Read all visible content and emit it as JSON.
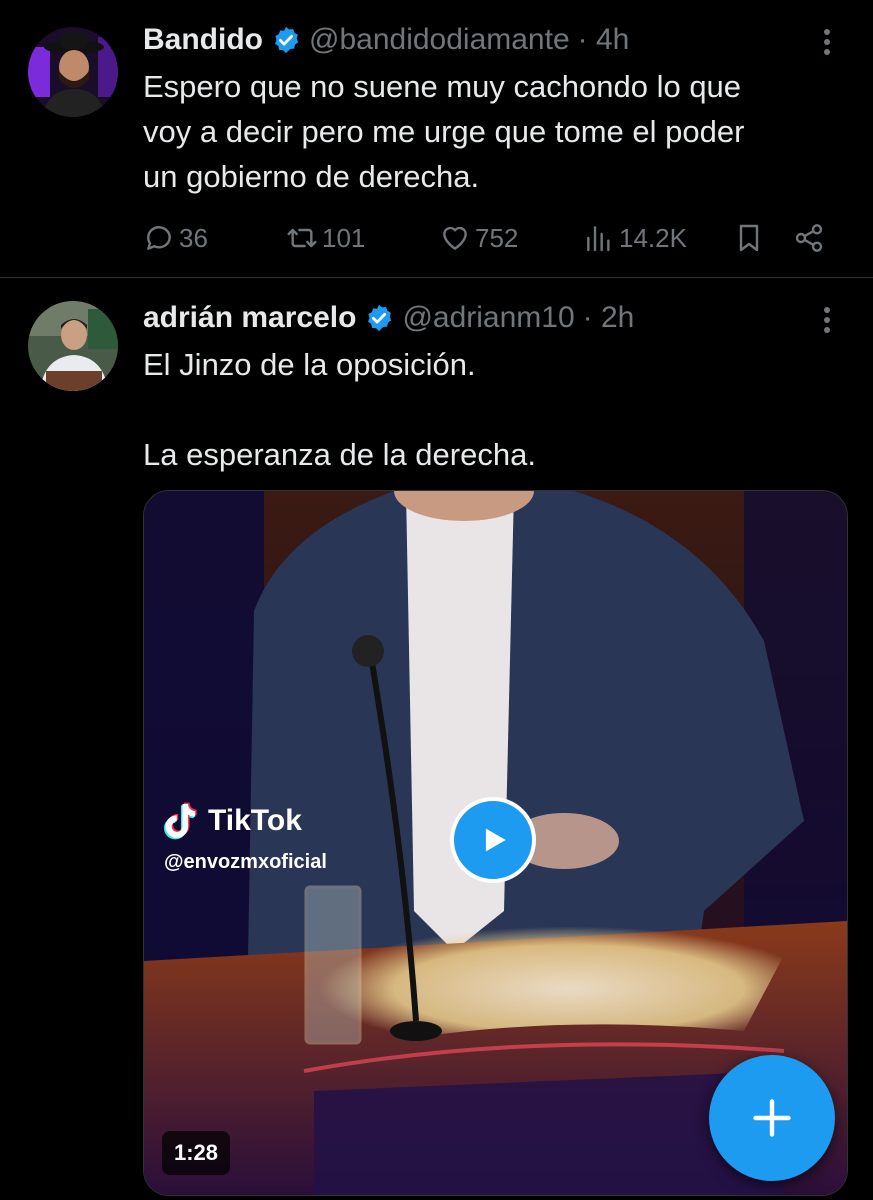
{
  "tweets": [
    {
      "name": "Bandido",
      "handle": "@bandidodiamante",
      "time": "· 4h",
      "lines": [
        "Espero que no suene muy cachondo lo que",
        "voy a decir pero me urge que tome el poder",
        "un gobierno de derecha."
      ],
      "stats": {
        "replies": "36",
        "reposts": "101",
        "likes": "752",
        "views": "14.2K"
      }
    },
    {
      "name": "adrián marcelo",
      "handle": "@adrianm10",
      "time": "· 2h",
      "lines": [
        "El Jinzo de la oposición.",
        "La esperanza de la derecha."
      ],
      "media": {
        "brand": "TikTok",
        "account": "@envozmxoficial",
        "duration": "1:28"
      }
    }
  ],
  "colors": {
    "accent": "#1d9bf0",
    "muted": "#71767b",
    "text": "#e7e9ea",
    "background": "#000000"
  },
  "icons": [
    "verified-badge-icon",
    "more-icon",
    "reply-icon",
    "repost-icon",
    "like-icon",
    "views-icon",
    "bookmark-icon",
    "share-icon",
    "play-icon",
    "tiktok-logo-icon",
    "compose-plus-icon"
  ]
}
